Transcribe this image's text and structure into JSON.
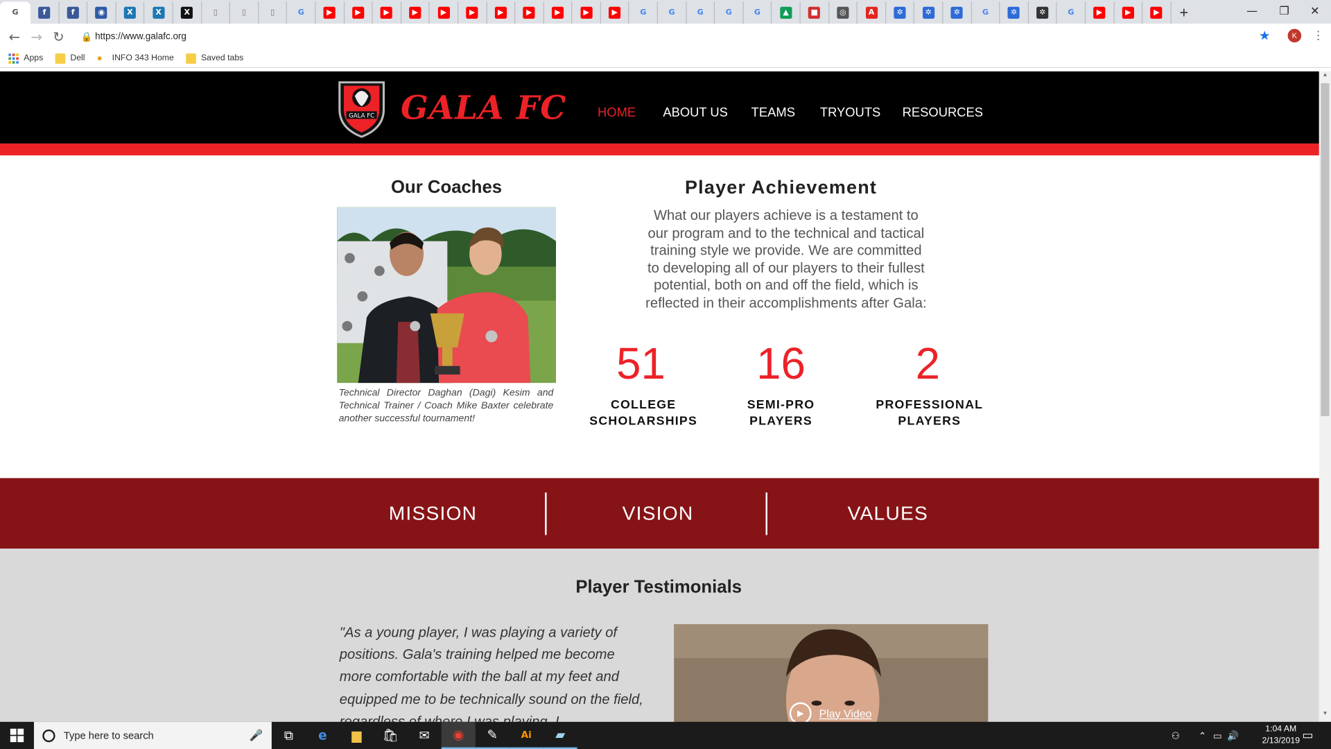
{
  "browser": {
    "tabs": [
      {
        "kind": "active",
        "glyph": "G",
        "color": "#dee1e6"
      },
      {
        "kind": "facebook",
        "glyph": "f",
        "color": "#3b5998"
      },
      {
        "kind": "facebook",
        "glyph": "f",
        "color": "#3b5998"
      },
      {
        "kind": "app",
        "glyph": "◉",
        "color": "#2e5aa5"
      },
      {
        "kind": "x",
        "glyph": "X",
        "color": "#1f77b4"
      },
      {
        "kind": "x",
        "glyph": "X",
        "color": "#1f77b4"
      },
      {
        "kind": "x",
        "glyph": "X",
        "color": "#111111"
      },
      {
        "kind": "doc",
        "glyph": "▯",
        "color": "#777777"
      },
      {
        "kind": "doc",
        "glyph": "▯",
        "color": "#777777"
      },
      {
        "kind": "doc",
        "glyph": "▯",
        "color": "#777777"
      },
      {
        "kind": "google",
        "glyph": "G",
        "color": "#4285f4"
      },
      {
        "kind": "youtube",
        "glyph": "▶",
        "color": "#ff0000"
      },
      {
        "kind": "youtube",
        "glyph": "▶",
        "color": "#ff0000"
      },
      {
        "kind": "youtube",
        "glyph": "▶",
        "color": "#ff0000"
      },
      {
        "kind": "youtube",
        "glyph": "▶",
        "color": "#ff0000"
      },
      {
        "kind": "youtube",
        "glyph": "▶",
        "color": "#ff0000"
      },
      {
        "kind": "youtube",
        "glyph": "▶",
        "color": "#ff0000"
      },
      {
        "kind": "youtube",
        "glyph": "▶",
        "color": "#ff0000"
      },
      {
        "kind": "youtube",
        "glyph": "▶",
        "color": "#ff0000"
      },
      {
        "kind": "youtube",
        "glyph": "▶",
        "color": "#ff0000"
      },
      {
        "kind": "youtube",
        "glyph": "▶",
        "color": "#ff0000"
      },
      {
        "kind": "youtube",
        "glyph": "▶",
        "color": "#ff0000"
      },
      {
        "kind": "google",
        "glyph": "G",
        "color": "#4285f4"
      },
      {
        "kind": "google",
        "glyph": "G",
        "color": "#4285f4"
      },
      {
        "kind": "google",
        "glyph": "G",
        "color": "#4285f4"
      },
      {
        "kind": "google",
        "glyph": "G",
        "color": "#4285f4"
      },
      {
        "kind": "google",
        "glyph": "G",
        "color": "#4285f4"
      },
      {
        "kind": "drive",
        "glyph": "▲",
        "color": "#0f9d58"
      },
      {
        "kind": "app",
        "glyph": "■",
        "color": "#d32f2f"
      },
      {
        "kind": "app",
        "glyph": "◎",
        "color": "#555555"
      },
      {
        "kind": "adobe",
        "glyph": "A",
        "color": "#e4261e"
      },
      {
        "kind": "app",
        "glyph": "✲",
        "color": "#2d6bd6"
      },
      {
        "kind": "app",
        "glyph": "✲",
        "color": "#2d6bd6"
      },
      {
        "kind": "app",
        "glyph": "✲",
        "color": "#2d6bd6"
      },
      {
        "kind": "google",
        "glyph": "G",
        "color": "#4285f4"
      },
      {
        "kind": "app",
        "glyph": "✲",
        "color": "#2d6bd6"
      },
      {
        "kind": "app",
        "glyph": "✲",
        "color": "#333333"
      },
      {
        "kind": "google",
        "glyph": "G",
        "color": "#4285f4"
      },
      {
        "kind": "youtube",
        "glyph": "▶",
        "color": "#ff0000"
      },
      {
        "kind": "youtube",
        "glyph": "▶",
        "color": "#ff0000"
      },
      {
        "kind": "youtube",
        "glyph": "▶",
        "color": "#ff0000"
      }
    ],
    "new_tab_glyph": "+",
    "window_controls": {
      "minimize": "—",
      "restore": "❐",
      "close": "✕"
    },
    "address": {
      "url": "https://www.galafc.org"
    },
    "profile_initial": "K",
    "bookmarks": [
      {
        "label": "Apps",
        "icon": "apps-grid-icon"
      },
      {
        "label": "Dell",
        "icon": "folder-icon"
      },
      {
        "label": "INFO 343 Home",
        "icon": "bulb-icon"
      },
      {
        "label": "Saved tabs",
        "icon": "folder-icon"
      }
    ]
  },
  "site": {
    "brand": "GALA FC",
    "crest_text": "GALA FC",
    "nav": [
      "HOME",
      "ABOUT US",
      "TEAMS",
      "TRYOUTS",
      "RESOURCES"
    ],
    "nav_active": "HOME",
    "colors": {
      "brand_red": "#ec2227",
      "band": "#861417",
      "header": "#000000",
      "grey": "#d9d9d9"
    },
    "coaches": {
      "title": "Our Coaches",
      "caption": "Technical Director Daghan (Dagi) Kesim and Technical Trainer / Coach Mike Baxter celebrate another successful tournament!"
    },
    "achievement": {
      "title": "Player Achievement",
      "text": "What our players achieve is a testament to our program and to the technical and tactical training style we provide. We are committed to developing all of our players to their fullest potential, both on and off the field, which is reflected in their accomplishments after Gala:",
      "stats": [
        {
          "value": "51",
          "label_1": "COLLEGE",
          "label_2": "SCHOLARSHIPS"
        },
        {
          "value": "16",
          "label_1": "SEMI-PRO",
          "label_2": "PLAYERS"
        },
        {
          "value": "2",
          "label_1": "PROFESSIONAL",
          "label_2": "PLAYERS"
        }
      ]
    },
    "band": [
      "MISSION",
      "VISION",
      "VALUES"
    ],
    "testimonials": {
      "title": "Player Testimonials",
      "quote": "\"As a young player, I was playing a variety of positions. Gala's training helped me become more comfortable with the ball at my feet and equipped me to be technically sound on the field, regardless of where I was playing. I",
      "play_label": "Play Video"
    }
  },
  "taskbar": {
    "search_placeholder": "Type here to search",
    "time": "1:04 AM",
    "date": "2/13/2019"
  }
}
